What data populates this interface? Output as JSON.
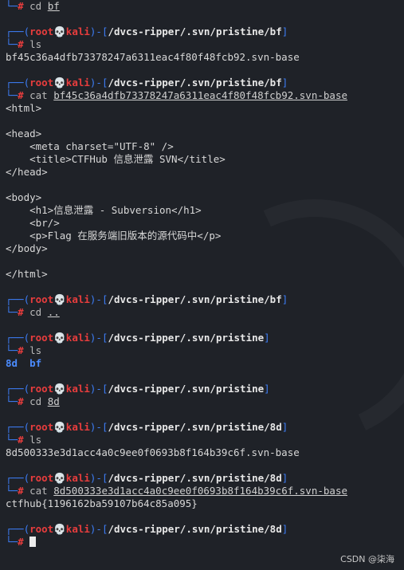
{
  "prompt": {
    "user": "root",
    "skull": "💀",
    "host": "kali",
    "hash_sign": "#"
  },
  "session": {
    "l1_cmd": "cd",
    "l1_arg": "bf",
    "p1_path": "/dvcs-ripper/.svn/pristine/bf",
    "p1_cmd": "ls",
    "out1": "bf45c36a4dfb73378247a6311eac4f80f48fcb92.svn-base",
    "p2_path": "/dvcs-ripper/.svn/pristine/bf",
    "p2_cmd": "cat",
    "p2_arg": "bf45c36a4dfb73378247a6311eac4f80f48fcb92.svn-base",
    "html_lines": [
      "<html>",
      "",
      "<head>",
      "    <meta charset=\"UTF-8\" />",
      "    <title>CTFHub 信息泄露 SVN</title>",
      "</head>",
      "",
      "<body>",
      "    <h1>信息泄露 - Subversion</h1>",
      "    <br/>",
      "    <p>Flag 在服务端旧版本的源代码中</p>",
      "</body>",
      "",
      "</html>"
    ],
    "p3_path": "/dvcs-ripper/.svn/pristine/bf",
    "p3_cmd": "cd",
    "p3_arg": "..",
    "p4_path": "/dvcs-ripper/.svn/pristine",
    "p4_cmd": "ls",
    "ls_dirs": [
      "8d",
      "bf"
    ],
    "p5_path": "/dvcs-ripper/.svn/pristine",
    "p5_cmd": "cd",
    "p5_arg": "8d",
    "p6_path": "/dvcs-ripper/.svn/pristine/8d",
    "p6_cmd": "ls",
    "out6": "8d500333e3d1acc4a0c9ee0f0693b8f164b39c6f.svn-base",
    "p7_path": "/dvcs-ripper/.svn/pristine/8d",
    "p7_cmd": "cat",
    "p7_arg": "8d500333e3d1acc4a0c9ee0f0693b8f164b39c6f.svn-base",
    "flag": "ctfhub{1196162ba59107b64c85a095}",
    "p8_path": "/dvcs-ripper/.svn/pristine/8d"
  },
  "watermark": "CSDN @柒海"
}
